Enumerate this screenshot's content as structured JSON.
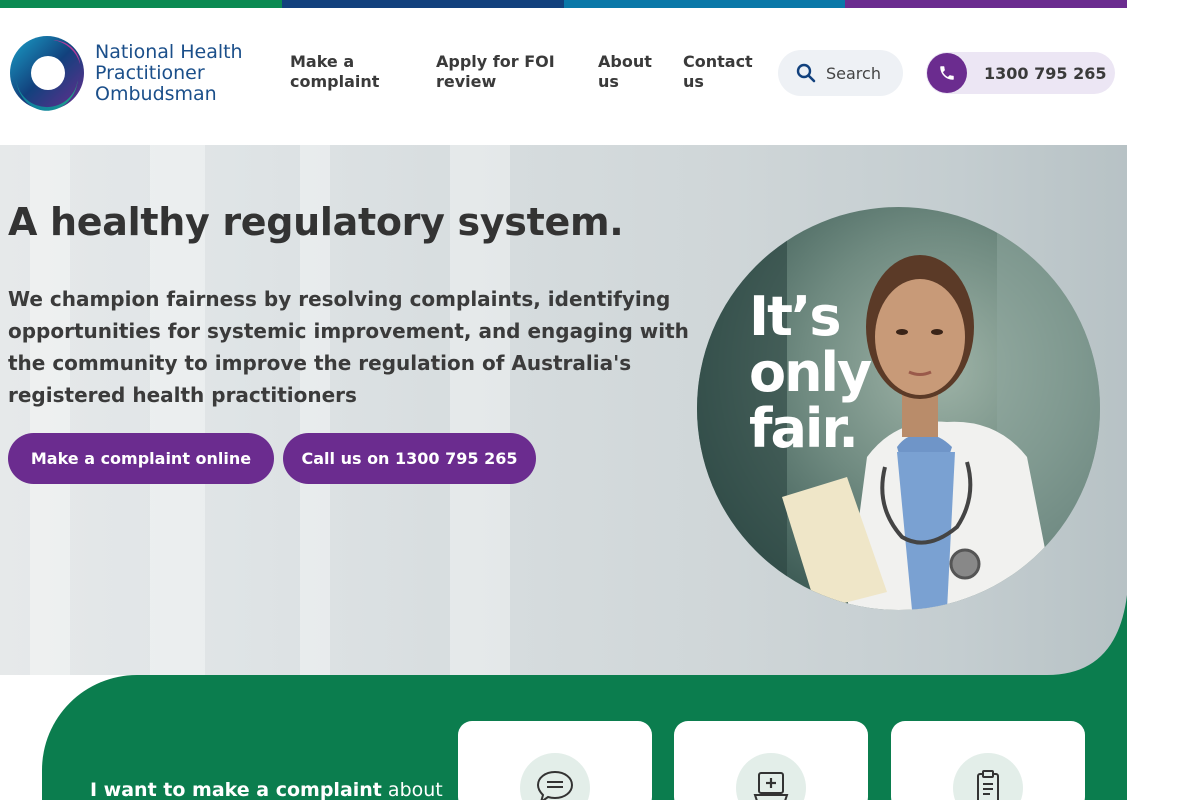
{
  "colors": {
    "topbar": [
      "#0b8a52",
      "#12417d",
      "#0a78a8",
      "#6b2c8f"
    ],
    "accent_purple": "#6b2c8f",
    "brand_green": "#0b7d4e",
    "brand_blue": "#1b4f8a"
  },
  "logo": {
    "line1": "National Health",
    "line2": "Practitioner",
    "line3": "Ombudsman"
  },
  "nav": {
    "items": [
      {
        "line1": "Make a",
        "line2": "complaint"
      },
      {
        "line1": "Apply for FOI",
        "line2": "review"
      },
      {
        "line1": "About",
        "line2": "us"
      },
      {
        "line1": "Contact",
        "line2": "us"
      }
    ],
    "search_label": "Search",
    "phone_label": "1300 795 265"
  },
  "hero": {
    "title": "A healthy regulatory system.",
    "text": "We champion fairness by resolving complaints, identifying opportunities for systemic improvement, and engaging with the community to improve the regulation of Australia's registered health practitioners",
    "primary_button": "Make a complaint online",
    "secondary_button": "Call us on 1300 795 265",
    "slogan_line1": "It’s",
    "slogan_line2": "only",
    "slogan_line3": "fair."
  },
  "complaint_panel": {
    "lead_bold": "I want to make a complaint",
    "lead_rest": " about",
    "cards": [
      {
        "icon": "chat-bubble-icon"
      },
      {
        "icon": "medical-monitor-icon"
      },
      {
        "icon": "clipboard-icon"
      }
    ]
  }
}
